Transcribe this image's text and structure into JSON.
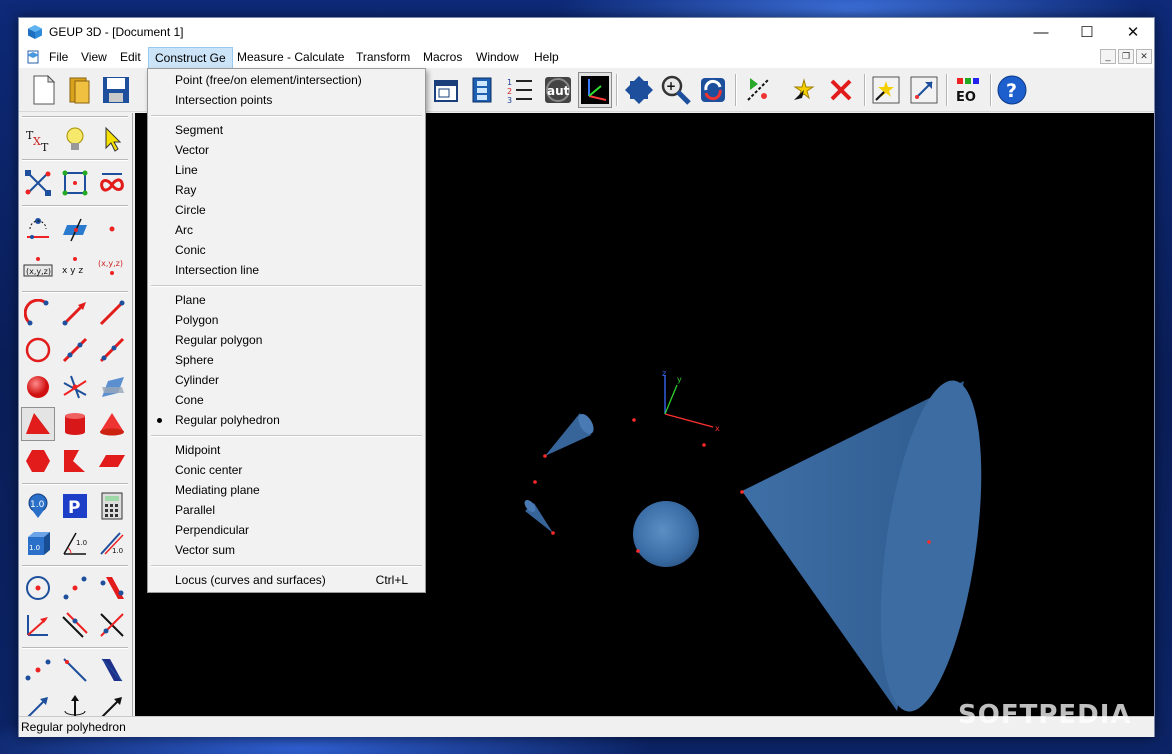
{
  "window": {
    "title": "GEUP 3D - [Document 1]"
  },
  "window_controls": {
    "minimize": "—",
    "maximize": "☐",
    "close": "✕"
  },
  "menubar": {
    "items": [
      {
        "label": "File"
      },
      {
        "label": "View"
      },
      {
        "label": "Edit"
      },
      {
        "label": "Construct Ge"
      },
      {
        "label": "Measure - Calculate"
      },
      {
        "label": "Transform"
      },
      {
        "label": "Macros"
      },
      {
        "label": "Window"
      },
      {
        "label": "Help"
      }
    ],
    "active": "Construct Ge"
  },
  "construct_menu": {
    "groups": [
      [
        {
          "label": "Point (free/on element/intersection)"
        },
        {
          "label": "Intersection points"
        }
      ],
      [
        {
          "label": "Segment"
        },
        {
          "label": "Vector"
        },
        {
          "label": "Line"
        },
        {
          "label": "Ray"
        },
        {
          "label": "Circle"
        },
        {
          "label": "Arc"
        },
        {
          "label": "Conic"
        },
        {
          "label": "Intersection line"
        }
      ],
      [
        {
          "label": "Plane"
        },
        {
          "label": "Polygon"
        },
        {
          "label": "Regular polygon"
        },
        {
          "label": "Sphere"
        },
        {
          "label": "Cylinder"
        },
        {
          "label": "Cone"
        },
        {
          "label": "Regular polyhedron",
          "checked": true
        }
      ],
      [
        {
          "label": "Midpoint"
        },
        {
          "label": "Conic center"
        },
        {
          "label": "Mediating plane"
        },
        {
          "label": "Parallel"
        },
        {
          "label": "Perpendicular"
        },
        {
          "label": "Vector sum"
        }
      ],
      [
        {
          "label": "Locus (curves and surfaces)",
          "shortcut": "Ctrl+L"
        }
      ]
    ]
  },
  "toolbar": {
    "icons": [
      "new-document-icon",
      "open-folder-icon",
      "save-disk-icon",
      "window-icon",
      "film-icon",
      "numbered-list-icon",
      "auto-icon",
      "axes-icon",
      "move-arrows-icon",
      "zoom-icon",
      "rotate-icon",
      "trace-icon",
      "star-pointer-icon",
      "delete-x-icon",
      "highlight-icon",
      "resize-icon",
      "eo-icon",
      "help-icon"
    ],
    "auto_label": "aut",
    "eo_label": "EO"
  },
  "left_panel": {
    "text_tool_label": "TXT",
    "coords_label_1": "(x,y,z)",
    "coords_label_2": "x y z",
    "coords_label_3": "(x,y,z)",
    "measure_label": "1.0",
    "param_label": "P"
  },
  "scene": {
    "axis_labels": {
      "x": "x",
      "y": "y",
      "z": "z"
    }
  },
  "status_bar": {
    "text": "Regular polyhedron"
  },
  "watermark": "SOFTPEDIA"
}
